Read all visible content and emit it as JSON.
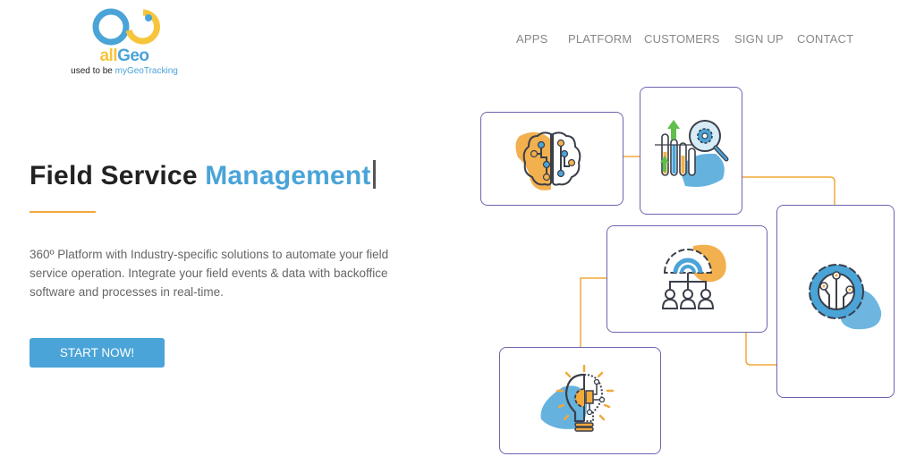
{
  "brand": {
    "name_part1": "all",
    "name_part2": "Geo",
    "tagline_prefix": "used to be ",
    "tagline_highlight": "myGeoTracking",
    "colors": {
      "blue": "#4aa4d8",
      "yellow": "#f6c53c"
    }
  },
  "nav": {
    "items": [
      {
        "label": "APPS"
      },
      {
        "label": "PLATFORM"
      },
      {
        "label": "CUSTOMERS"
      },
      {
        "label": "SIGN UP"
      },
      {
        "label": "CONTACT"
      }
    ]
  },
  "hero": {
    "title_part1": "Field Service ",
    "title_accent": "Management",
    "description": "360º Platform with Industry-specific solutions to automate your field service operation. Integrate your field events & data with backoffice software and processes in real-time.",
    "cta_label": "START NOW!"
  },
  "illustration": {
    "cards": [
      {
        "icon": "brain-circuit-icon"
      },
      {
        "icon": "analytics-magnifier-gear-icon"
      },
      {
        "icon": "gear-team-hierarchy-icon"
      },
      {
        "icon": "gear-circuit-icon"
      },
      {
        "icon": "lightbulb-gear-circuit-icon"
      }
    ],
    "colors": {
      "border": "#6b64b0",
      "connector": "#f2a93b",
      "orange": "#f2b04e",
      "blue": "#4aa4d8",
      "dark": "#3a3f4a"
    }
  }
}
